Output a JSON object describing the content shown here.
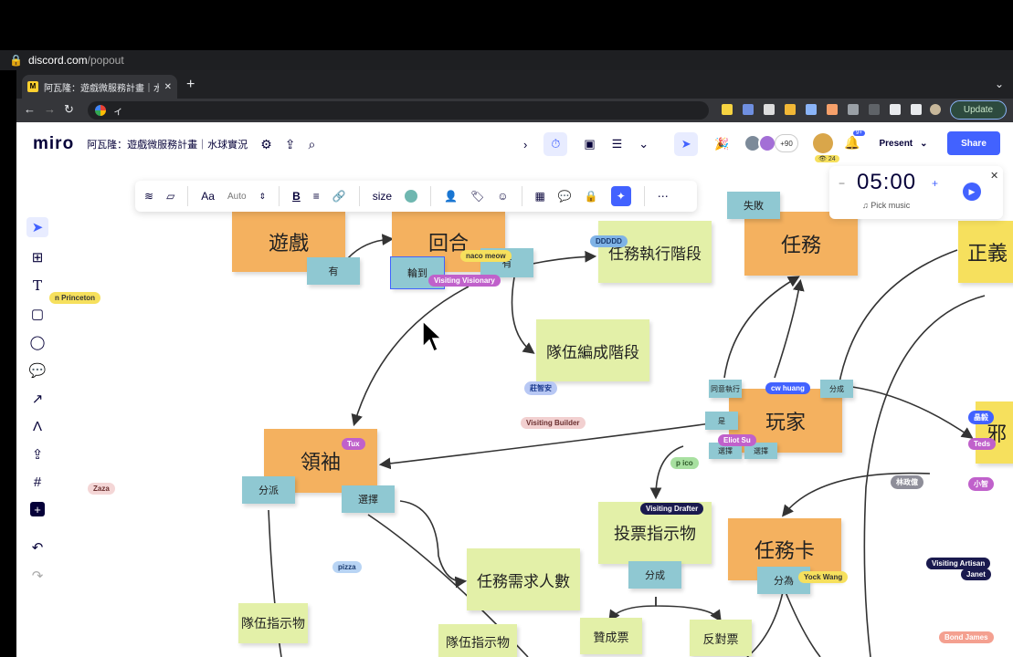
{
  "discord": {
    "host": "discord.com",
    "path": "/popout"
  },
  "browser": {
    "tab_title": "阿瓦隆：遊戲微服務計畫｜水球軟...",
    "address": "ィ",
    "update_label": "Update"
  },
  "miro": {
    "logo": "miro",
    "board_title": "阿瓦隆：遊戲微服務計畫｜水球實況",
    "collab_count": "+90",
    "viewers": "24",
    "present_label": "Present",
    "share_label": "Share",
    "notification_count": "9+"
  },
  "format_bar": {
    "font_size_auto": "Auto",
    "size_label": "size"
  },
  "timer": {
    "minutes": "05",
    "seconds": "00",
    "music_label": "Pick music"
  },
  "stickies": {
    "game": "遊戲",
    "round": "回合",
    "task": "任務",
    "leader": "領袖",
    "player": "玩家",
    "task_card": "任務卡",
    "mission_phase": "任務執行階段",
    "team_phase": "隊伍編成階段",
    "vote_indicator": "投票指示物",
    "team_count": "任務需求人數",
    "team_indicator_1": "隊伍指示物",
    "team_indicator_2": "隊伍指示物",
    "approve": "贊成票",
    "reject": "反對票",
    "justice": "正義",
    "evil": "邪"
  },
  "labels": {
    "have": "有",
    "have2": "有",
    "turn": "輪到",
    "fail": "失敗",
    "agree_exec": "同意執行",
    "divide1": "分成",
    "is": "是",
    "select1": "選擇",
    "select2": "選擇",
    "dispatch": "分派",
    "choose": "選擇",
    "divide2": "分成",
    "divide_into": "分為"
  },
  "cursors": [
    {
      "name": "naco meow",
      "color": "#f6e05d",
      "text": "#333"
    },
    {
      "name": "Visiting Visionary",
      "color": "#c061cb",
      "text": "#fff"
    },
    {
      "name": "DDDDD",
      "color": "#7fb3e6",
      "text": "#1a3a6e"
    },
    {
      "name": "n Princeton",
      "color": "#f6e05d",
      "text": "#333"
    },
    {
      "name": "莊智安",
      "color": "#b8c8f4",
      "text": "#1a3a8e"
    },
    {
      "name": "cw huang",
      "color": "#4262ff",
      "text": "#fff"
    },
    {
      "name": "Visiting Builder",
      "color": "#f2d0d0",
      "text": "#6b3030"
    },
    {
      "name": "Tux",
      "color": "#c061cb",
      "text": "#fff"
    },
    {
      "name": "Eliot Su",
      "color": "#c061cb",
      "text": "#fff"
    },
    {
      "name": "p ico",
      "color": "#a8e0a0",
      "text": "#2e5a2a"
    },
    {
      "name": "Zaza",
      "color": "#f4d6d6",
      "text": "#6b3030"
    },
    {
      "name": "Visiting Drafter",
      "color": "#1a1a4e",
      "text": "#fff"
    },
    {
      "name": "林政億",
      "color": "#8e8e99",
      "text": "#fff"
    },
    {
      "name": "pizza",
      "color": "#b8d4f4",
      "text": "#1a3a6e"
    },
    {
      "name": "Yock Wang",
      "color": "#f6e05d",
      "text": "#333"
    },
    {
      "name": "Visiting Artisan",
      "color": "#1a1a4e",
      "text": "#fff"
    },
    {
      "name": "Janet",
      "color": "#1a1a4e",
      "text": "#fff"
    },
    {
      "name": "Bond James",
      "color": "#f4a090",
      "text": "#fff"
    },
    {
      "name": "晶毅",
      "color": "#4262ff",
      "text": "#fff"
    },
    {
      "name": "Teds",
      "color": "#c061cb",
      "text": "#fff"
    },
    {
      "name": "小智",
      "color": "#c061cb",
      "text": "#fff"
    }
  ]
}
